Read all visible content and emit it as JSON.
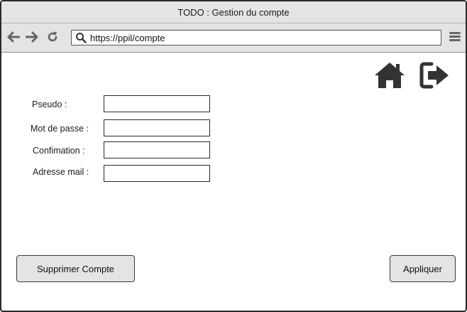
{
  "window": {
    "title": "TODO : Gestion du compte"
  },
  "browser": {
    "url": "https://ppil/compte",
    "icons": {
      "back": "arrow-left-icon",
      "forward": "arrow-right-icon",
      "reload": "reload-icon",
      "search": "search-icon",
      "menu": "hamburger-menu-icon"
    }
  },
  "header_icons": {
    "home": "home-icon",
    "logout": "logout-icon"
  },
  "form": {
    "fields": [
      {
        "label": "Pseudo :",
        "value": ""
      },
      {
        "label": "Mot de passe :",
        "value": ""
      },
      {
        "label": "Confimation :",
        "value": ""
      },
      {
        "label": "Adresse mail :",
        "value": ""
      }
    ]
  },
  "actions": {
    "delete_label": "Supprimer Compte",
    "apply_label": "Appliquer"
  },
  "colors": {
    "chrome": "#e4e4e4",
    "icon_dark": "#333333",
    "icon_gray": "#666666",
    "border": "#2a2a2a"
  }
}
